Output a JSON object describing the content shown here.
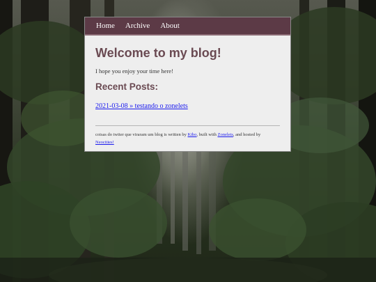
{
  "nav": {
    "home": "Home",
    "archive": "Archive",
    "about": "About"
  },
  "main": {
    "title": "Welcome to my blog!",
    "intro": "I hope you enjoy your time here!",
    "recent_heading": "Recent Posts:",
    "posts": [
      {
        "label": "2021-03-08 » testando o zonelets"
      }
    ]
  },
  "footer": {
    "text_1": "coisas do twiter que viraram um blog is written by ",
    "author": "Kibo",
    "text_2": ", built with ",
    "engine": "Zonelets",
    "text_3": ", and hosted by ",
    "host": "Neocities!"
  },
  "colors": {
    "nav_bg": "#5c3a46",
    "heading": "#6a4a52",
    "link": "#1a1aee",
    "card_bg": "#eeeeee"
  }
}
